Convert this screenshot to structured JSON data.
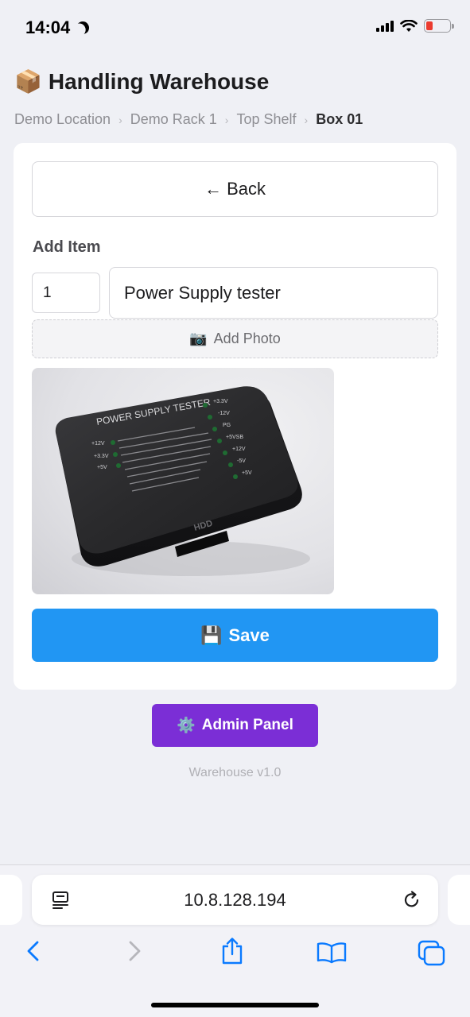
{
  "status_bar": {
    "time": "14:04"
  },
  "header": {
    "title": "Handling Warehouse",
    "title_icon": "📦"
  },
  "breadcrumb": {
    "items": [
      "Demo Location",
      "Demo Rack 1",
      "Top Shelf",
      "Box 01"
    ],
    "separator": "›"
  },
  "form": {
    "back_label": "← Back",
    "section_label": "Add Item",
    "quantity_value": "1",
    "name_value": "Power Supply tester",
    "add_photo_icon": "📷",
    "add_photo_label": "Add Photo",
    "photo": {
      "device_title": "POWER SUPPLY TESTER",
      "port_label": "HDD"
    },
    "save_icon": "💾",
    "save_label": "Save"
  },
  "admin": {
    "icon": "⚙️",
    "label": "Admin Panel"
  },
  "footer": {
    "version": "Warehouse v1.0"
  },
  "browser": {
    "url": "10.8.128.194"
  },
  "colors": {
    "accent_blue": "#2196f3",
    "admin_purple": "#7b2ed6",
    "ios_blue": "#0a7aff",
    "battery_low": "#eb3b2f"
  }
}
